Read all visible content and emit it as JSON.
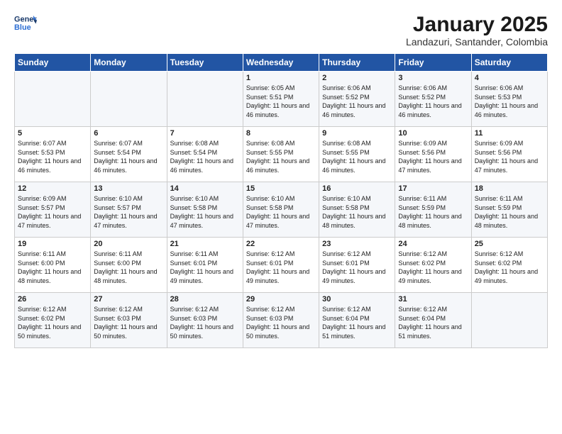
{
  "logo": {
    "line1": "General",
    "line2": "Blue"
  },
  "title": "January 2025",
  "subtitle": "Landazuri, Santander, Colombia",
  "days_of_week": [
    "Sunday",
    "Monday",
    "Tuesday",
    "Wednesday",
    "Thursday",
    "Friday",
    "Saturday"
  ],
  "weeks": [
    [
      {
        "day": "",
        "info": ""
      },
      {
        "day": "",
        "info": ""
      },
      {
        "day": "",
        "info": ""
      },
      {
        "day": "1",
        "info": "Sunrise: 6:05 AM\nSunset: 5:51 PM\nDaylight: 11 hours and 46 minutes."
      },
      {
        "day": "2",
        "info": "Sunrise: 6:06 AM\nSunset: 5:52 PM\nDaylight: 11 hours and 46 minutes."
      },
      {
        "day": "3",
        "info": "Sunrise: 6:06 AM\nSunset: 5:52 PM\nDaylight: 11 hours and 46 minutes."
      },
      {
        "day": "4",
        "info": "Sunrise: 6:06 AM\nSunset: 5:53 PM\nDaylight: 11 hours and 46 minutes."
      }
    ],
    [
      {
        "day": "5",
        "info": "Sunrise: 6:07 AM\nSunset: 5:53 PM\nDaylight: 11 hours and 46 minutes."
      },
      {
        "day": "6",
        "info": "Sunrise: 6:07 AM\nSunset: 5:54 PM\nDaylight: 11 hours and 46 minutes."
      },
      {
        "day": "7",
        "info": "Sunrise: 6:08 AM\nSunset: 5:54 PM\nDaylight: 11 hours and 46 minutes."
      },
      {
        "day": "8",
        "info": "Sunrise: 6:08 AM\nSunset: 5:55 PM\nDaylight: 11 hours and 46 minutes."
      },
      {
        "day": "9",
        "info": "Sunrise: 6:08 AM\nSunset: 5:55 PM\nDaylight: 11 hours and 46 minutes."
      },
      {
        "day": "10",
        "info": "Sunrise: 6:09 AM\nSunset: 5:56 PM\nDaylight: 11 hours and 47 minutes."
      },
      {
        "day": "11",
        "info": "Sunrise: 6:09 AM\nSunset: 5:56 PM\nDaylight: 11 hours and 47 minutes."
      }
    ],
    [
      {
        "day": "12",
        "info": "Sunrise: 6:09 AM\nSunset: 5:57 PM\nDaylight: 11 hours and 47 minutes."
      },
      {
        "day": "13",
        "info": "Sunrise: 6:10 AM\nSunset: 5:57 PM\nDaylight: 11 hours and 47 minutes."
      },
      {
        "day": "14",
        "info": "Sunrise: 6:10 AM\nSunset: 5:58 PM\nDaylight: 11 hours and 47 minutes."
      },
      {
        "day": "15",
        "info": "Sunrise: 6:10 AM\nSunset: 5:58 PM\nDaylight: 11 hours and 47 minutes."
      },
      {
        "day": "16",
        "info": "Sunrise: 6:10 AM\nSunset: 5:58 PM\nDaylight: 11 hours and 48 minutes."
      },
      {
        "day": "17",
        "info": "Sunrise: 6:11 AM\nSunset: 5:59 PM\nDaylight: 11 hours and 48 minutes."
      },
      {
        "day": "18",
        "info": "Sunrise: 6:11 AM\nSunset: 5:59 PM\nDaylight: 11 hours and 48 minutes."
      }
    ],
    [
      {
        "day": "19",
        "info": "Sunrise: 6:11 AM\nSunset: 6:00 PM\nDaylight: 11 hours and 48 minutes."
      },
      {
        "day": "20",
        "info": "Sunrise: 6:11 AM\nSunset: 6:00 PM\nDaylight: 11 hours and 48 minutes."
      },
      {
        "day": "21",
        "info": "Sunrise: 6:11 AM\nSunset: 6:01 PM\nDaylight: 11 hours and 49 minutes."
      },
      {
        "day": "22",
        "info": "Sunrise: 6:12 AM\nSunset: 6:01 PM\nDaylight: 11 hours and 49 minutes."
      },
      {
        "day": "23",
        "info": "Sunrise: 6:12 AM\nSunset: 6:01 PM\nDaylight: 11 hours and 49 minutes."
      },
      {
        "day": "24",
        "info": "Sunrise: 6:12 AM\nSunset: 6:02 PM\nDaylight: 11 hours and 49 minutes."
      },
      {
        "day": "25",
        "info": "Sunrise: 6:12 AM\nSunset: 6:02 PM\nDaylight: 11 hours and 49 minutes."
      }
    ],
    [
      {
        "day": "26",
        "info": "Sunrise: 6:12 AM\nSunset: 6:02 PM\nDaylight: 11 hours and 50 minutes."
      },
      {
        "day": "27",
        "info": "Sunrise: 6:12 AM\nSunset: 6:03 PM\nDaylight: 11 hours and 50 minutes."
      },
      {
        "day": "28",
        "info": "Sunrise: 6:12 AM\nSunset: 6:03 PM\nDaylight: 11 hours and 50 minutes."
      },
      {
        "day": "29",
        "info": "Sunrise: 6:12 AM\nSunset: 6:03 PM\nDaylight: 11 hours and 50 minutes."
      },
      {
        "day": "30",
        "info": "Sunrise: 6:12 AM\nSunset: 6:04 PM\nDaylight: 11 hours and 51 minutes."
      },
      {
        "day": "31",
        "info": "Sunrise: 6:12 AM\nSunset: 6:04 PM\nDaylight: 11 hours and 51 minutes."
      },
      {
        "day": "",
        "info": ""
      }
    ]
  ]
}
